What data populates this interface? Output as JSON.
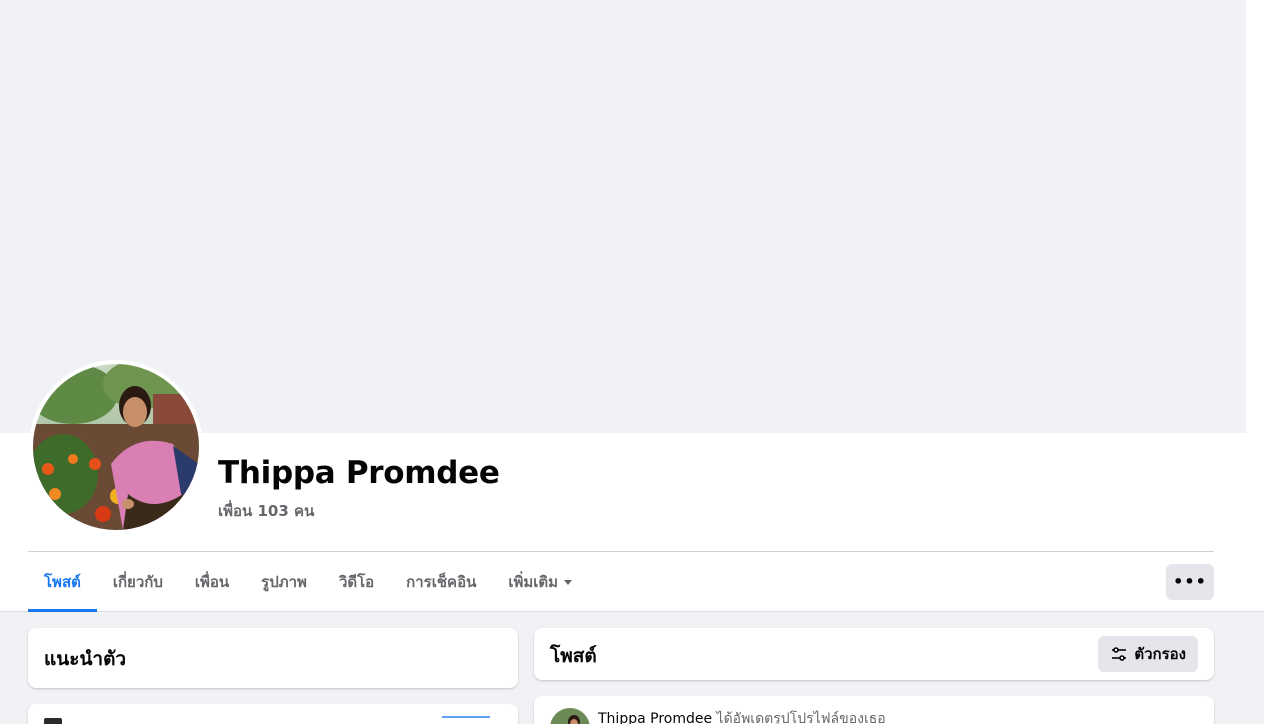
{
  "profile": {
    "name": "Thippa Promdee",
    "friends": "เพื่อน 103 คน"
  },
  "tabs": [
    {
      "label": "โพสต์",
      "active": true
    },
    {
      "label": "เกี่ยวกับ"
    },
    {
      "label": "เพื่อน"
    },
    {
      "label": "รูปภาพ"
    },
    {
      "label": "วิดีโอ"
    },
    {
      "label": "การเช็คอิน"
    },
    {
      "label": "เพิ่มเติม"
    }
  ],
  "more_button": "•••",
  "intro": {
    "title": "แนะนำตัว"
  },
  "posts": {
    "title": "โพสต์",
    "filter_label": "ตัวกรอง"
  },
  "post": {
    "author": "Thippa Promdee",
    "action": "ได้อัพเดตรูปโปรไฟล์ของเธอ"
  },
  "colors": {
    "accent": "#1877f2",
    "background": "#f0f2f5",
    "secondary_text": "#65676b",
    "button_bg": "#e4e6eb"
  }
}
